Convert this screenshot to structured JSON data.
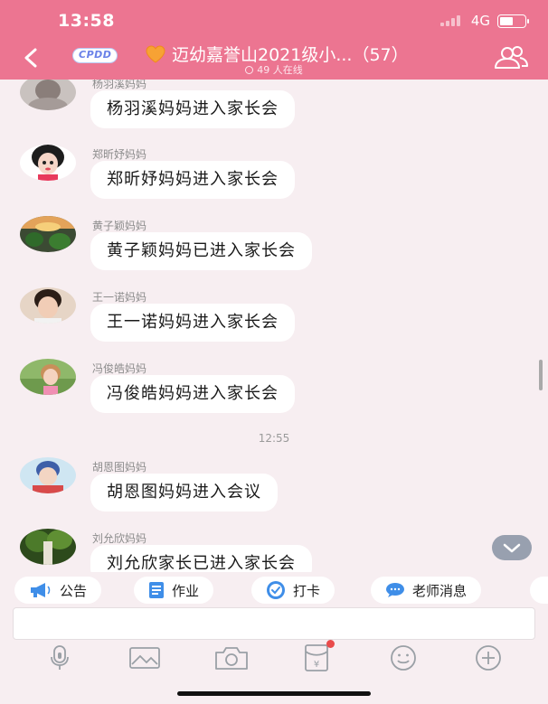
{
  "status_bar": {
    "time": "13:58",
    "network": "4G",
    "battery_level": 0.55
  },
  "header": {
    "badge": "CPDD",
    "title": "迈幼嘉誉山2021级小...（57）",
    "online": "49 人在线",
    "icons": {
      "back": "chevron-left-icon",
      "members": "group-members-icon",
      "heart": "heart-icon"
    }
  },
  "colors": {
    "header_bg": "#ec7591",
    "chat_bg": "#f7eef1",
    "bubble_bg": "#ffffff",
    "notice_dot": "#e94b4b"
  },
  "messages": [
    {
      "sender": "杨羽溪妈妈",
      "text": "杨羽溪妈妈进入家长会"
    },
    {
      "sender": "郑昕妤妈妈",
      "text": "郑昕妤妈妈进入家长会"
    },
    {
      "sender": "黄子颖妈妈",
      "text": "黄子颖妈妈已进入家长会"
    },
    {
      "sender": "王一诺妈妈",
      "text": "王一诺妈妈进入家长会"
    },
    {
      "sender": "冯俊皓妈妈",
      "text": "冯俊皓妈妈进入家长会"
    },
    {
      "sender": "胡恩图妈妈",
      "text": "胡恩图妈妈进入会议"
    },
    {
      "sender": "刘允欣妈妈",
      "text": "刘允欣家长已进入家长会"
    }
  ],
  "time_divider": "12:55",
  "quick_actions": [
    {
      "label": "公告",
      "icon": "megaphone-icon"
    },
    {
      "label": "作业",
      "icon": "document-icon"
    },
    {
      "label": "打卡",
      "icon": "check-in-icon"
    },
    {
      "label": "老师消息",
      "icon": "chat-bubble-icon"
    }
  ],
  "input": {
    "value": "",
    "placeholder": ""
  },
  "toolbar": [
    {
      "icon": "microphone-icon"
    },
    {
      "icon": "image-icon"
    },
    {
      "icon": "camera-icon"
    },
    {
      "icon": "red-packet-icon",
      "badge": true
    },
    {
      "icon": "emoji-icon"
    },
    {
      "icon": "plus-icon"
    }
  ]
}
